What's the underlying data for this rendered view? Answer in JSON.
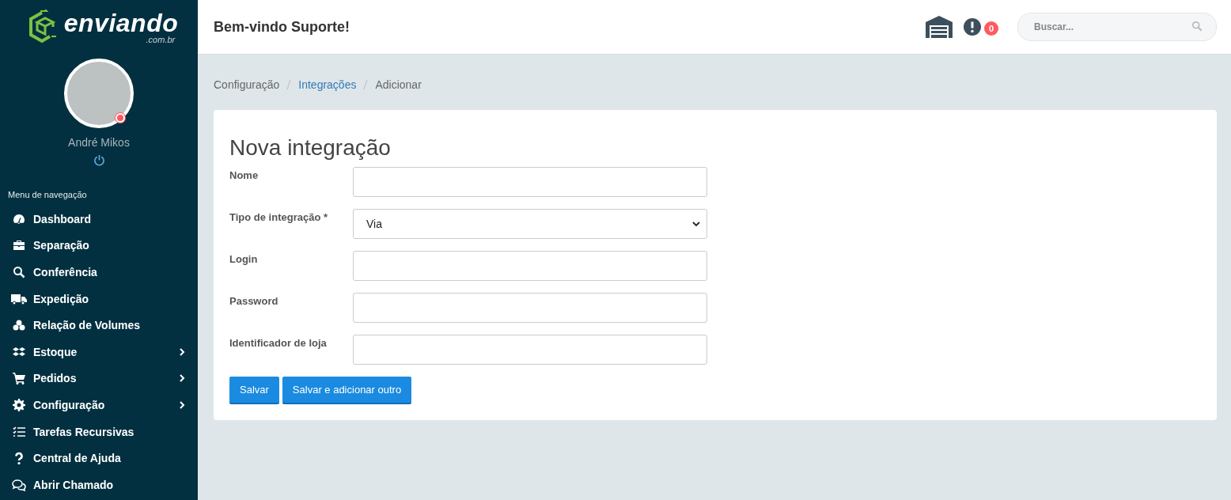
{
  "logo": {
    "name": "enviando",
    "domain": ".com.br"
  },
  "user": {
    "name": "André Mikos",
    "online": false
  },
  "sidebar": {
    "heading": "Menu de navegação",
    "items": [
      {
        "label": "Dashboard",
        "has_submenu": false
      },
      {
        "label": "Separação",
        "has_submenu": false
      },
      {
        "label": "Conferência",
        "has_submenu": false
      },
      {
        "label": "Expedição",
        "has_submenu": false
      },
      {
        "label": "Relação de Volumes",
        "has_submenu": false
      },
      {
        "label": "Estoque",
        "has_submenu": true
      },
      {
        "label": "Pedidos",
        "has_submenu": true
      },
      {
        "label": "Configuração",
        "has_submenu": true
      },
      {
        "label": "Tarefas Recursivas",
        "has_submenu": false
      },
      {
        "label": "Central de Ajuda",
        "has_submenu": false
      },
      {
        "label": "Abrir Chamado",
        "has_submenu": false
      }
    ]
  },
  "header": {
    "title": "Bem-vindo Suporte!",
    "alerts_count": "0",
    "search": {
      "placeholder": "Buscar..."
    }
  },
  "breadcrumb": [
    {
      "label": "Configuração",
      "link": false
    },
    {
      "label": "Integrações",
      "link": true
    },
    {
      "label": "Adicionar",
      "link": false
    }
  ],
  "form": {
    "title": "Nova integração",
    "fields": [
      {
        "label": "Nome",
        "kind": "text"
      },
      {
        "label": "Tipo de integração *",
        "kind": "select",
        "value": "Via"
      },
      {
        "label": "Login",
        "kind": "text"
      },
      {
        "label": "Password",
        "kind": "text"
      },
      {
        "label": "Identificador de loja",
        "kind": "text"
      }
    ],
    "buttons": [
      "Salvar",
      "Salvar e adicionar outro"
    ]
  }
}
